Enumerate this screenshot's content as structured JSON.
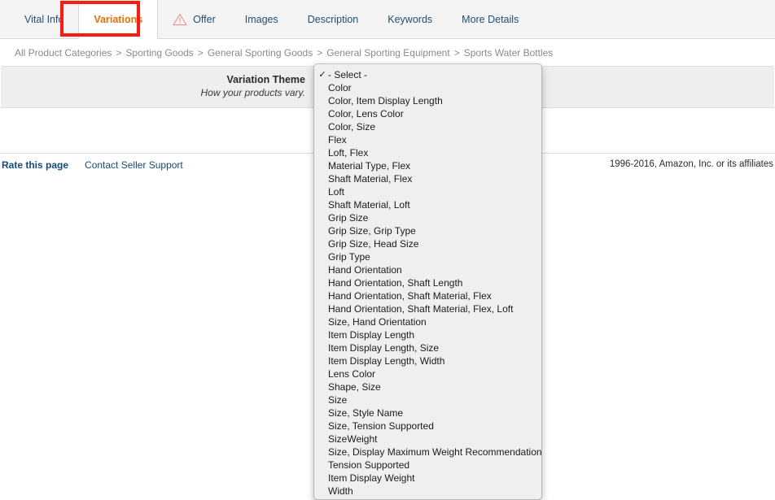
{
  "tabs": [
    {
      "label": "Vital Info",
      "icon": null,
      "active": false
    },
    {
      "label": "Variations",
      "icon": null,
      "active": true
    },
    {
      "label": "Offer",
      "icon": "warning-triangle-icon",
      "active": false
    },
    {
      "label": "Images",
      "icon": null,
      "active": false
    },
    {
      "label": "Description",
      "icon": null,
      "active": false
    },
    {
      "label": "Keywords",
      "icon": null,
      "active": false
    },
    {
      "label": "More Details",
      "icon": null,
      "active": false
    }
  ],
  "breadcrumb": [
    "All Product Categories",
    "Sporting Goods",
    "General Sporting Goods",
    "General Sporting Equipment",
    "Sports Water Bottles"
  ],
  "breadcrumb_separator": ">",
  "form": {
    "field_label": "Variation Theme",
    "field_hint": "How your products vary."
  },
  "dropdown": {
    "selected": "- Select -",
    "check_glyph": "✓",
    "options": [
      "- Select -",
      "Color",
      "Color, Item Display Length",
      "Color, Lens Color",
      "Color, Size",
      "Flex",
      "Loft, Flex",
      "Material Type, Flex",
      "Shaft Material, Flex",
      "Loft",
      "Shaft Material, Loft",
      "Grip Size",
      "Grip Size, Grip Type",
      "Grip Size, Head Size",
      "Grip Type",
      "Hand Orientation",
      "Hand Orientation, Shaft Length",
      "Hand Orientation, Shaft Material, Flex",
      "Hand Orientation, Shaft Material, Flex, Loft",
      "Size, Hand Orientation",
      "Item Display Length",
      "Item Display Length, Size",
      "Item Display Length, Width",
      "Lens Color",
      "Shape, Size",
      "Size",
      "Size, Style Name",
      "Size, Tension Supported",
      "SizeWeight",
      "Size, Display Maximum Weight Recommendation",
      "Tension Supported",
      "Item Display Weight",
      "Width"
    ]
  },
  "footer": {
    "rate_link": "Rate this page",
    "support_link": "Contact Seller Support",
    "copyright": "1996-2016, Amazon, Inc. or its affiliates"
  },
  "colors": {
    "active_tab_text": "#e8700a",
    "tab_text": "#1f4e72",
    "annotation_box": "#ff1a0d",
    "warning_icon": "#e8a0a0",
    "link": "#134b7d",
    "panel_bg": "#eeeeee",
    "dropdown_bg": "#efefef"
  }
}
